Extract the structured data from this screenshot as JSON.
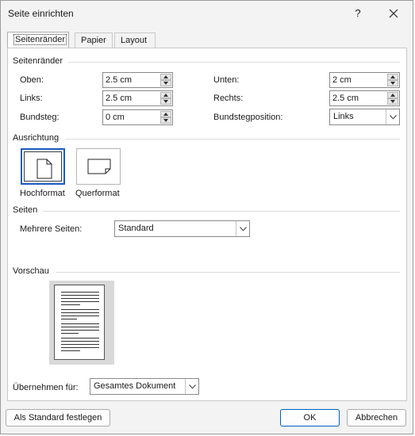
{
  "window": {
    "title": "Seite einrichten",
    "help_glyph": "?"
  },
  "tabs": [
    {
      "label": "Seitenränder",
      "active": true
    },
    {
      "label": "Papier",
      "active": false
    },
    {
      "label": "Layout",
      "active": false
    }
  ],
  "margins": {
    "section_title": "Seitenränder",
    "top": {
      "label": "Oben:",
      "value": "2.5 cm"
    },
    "bottom": {
      "label": "Unten:",
      "value": "2 cm"
    },
    "left": {
      "label": "Links:",
      "value": "2.5 cm"
    },
    "right": {
      "label": "Rechts:",
      "value": "2.5 cm"
    },
    "gutter": {
      "label": "Bundsteg:",
      "value": "0 cm"
    },
    "gutter_position": {
      "label": "Bundstegposition:",
      "value": "Links"
    }
  },
  "orientation": {
    "section_title": "Ausrichtung",
    "portrait_label": "Hochformat",
    "landscape_label": "Querformat",
    "selected": "portrait"
  },
  "pages": {
    "section_title": "Seiten",
    "multiple_pages_label": "Mehrere Seiten:",
    "multiple_pages_value": "Standard"
  },
  "preview": {
    "section_title": "Vorschau"
  },
  "apply_to": {
    "label": "Übernehmen für:",
    "value": "Gesamtes Dokument"
  },
  "buttons": {
    "set_default": "Als Standard festlegen",
    "ok": "OK",
    "cancel": "Abbrechen"
  },
  "colors": {
    "accent": "#1d5bbf",
    "dialog_bg": "#f3f3f3",
    "panel_bg": "#ffffff"
  }
}
